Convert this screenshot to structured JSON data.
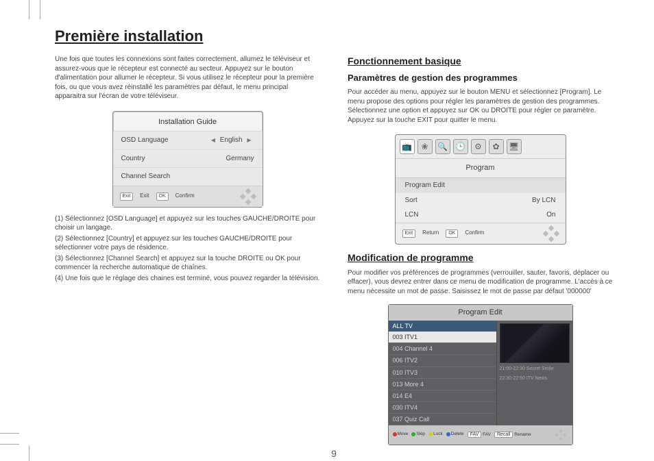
{
  "title": "Première installation",
  "page_number": "9",
  "left": {
    "intro": "Une fois que toutes les connexions sont faites correctement, allumez le téléviseur et assurez-vous que le récepteur est connecté au secteur. Appuyez sur le bouton d'alimentation pour allumer le récepteur. Si vous utilisez le récepteur pour la première fois, ou que vous avez réinstallé les paramètres par défaut, le menu principal apparaitra sur l'écran de votre téléviseur.",
    "osd": {
      "title": "Installation Guide",
      "osd_language_label": "OSD Language",
      "osd_language_value": "English",
      "country_label": "Country",
      "country_value": "Germany",
      "channel_search_label": "Channel Search",
      "exit_key": "Exit",
      "exit_label": "Exit",
      "ok_key": "OK",
      "ok_label": "Confirm"
    },
    "steps": {
      "s1": "(1) Sélectionnez [OSD Language] et appuyez sur les touches GAUCHE/DROITE pour choisir un langage.",
      "s2": "(2) Sélectionnez [Country] et appuyez sur les touches GAUCHE/DROITE pour sélectionner votre pays de résidence.",
      "s3": "(3) Sélectionnez [Channel Search] et appuyez sur la touche DROITE ou OK pour commencer la recherche automatique de chaînes.",
      "s4": "(4) Une fois que le réglage des chaines est terminé, vous pouvez regarder la télévision."
    }
  },
  "right": {
    "sec1_title": "Fonctionnement basique",
    "sec1_sub": "Paramètres de gestion des programmes",
    "sec1_body": "Pour accéder au menu, appuyez sur le bouton MENU et sélectionnez [Program]. Le menu propose des options pour régler les paramètres de gestion des programmes. Sélectionnez une option et appuyez sur OK ou DROITE pour régler ce paramètre. Appuyez sur la touche EXIT pour quitter le menu.",
    "osd2": {
      "title": "Program",
      "program_edit": "Program Edit",
      "sort_label": "Sort",
      "sort_value": "By LCN",
      "lcn_label": "LCN",
      "lcn_value": "On",
      "exit_key": "Exit",
      "exit_label": "Return",
      "ok_key": "OK",
      "ok_label": "Confirm"
    },
    "sec2_title": "Modification de programme",
    "sec2_body": "Pour modifier vos préférences de programmes (verrouiller, sauter, favoris, déplacer ou effacer), vous devrez entrer dans  ce menu de modification de programme. L'accès à ce menu nécessite un mot de passe. Saisissez le mot de passe par défaut '000000'",
    "osd3": {
      "title": "Program Edit",
      "header": "ALL TV",
      "channels": [
        "003 ITV1",
        "004 Channel 4",
        "006 ITV2",
        "010 ITV3",
        "013 More 4",
        "014 E4",
        "030 ITV4",
        "037 Quiz Call"
      ],
      "info1": "21:00-22:30  Secret Smile",
      "info2": "22:30-22:50  ITV News",
      "tools": {
        "move": "Move",
        "skip": "Skip",
        "lock": "Lock",
        "delete": "Delete",
        "fav_key": "FAV",
        "fav": "FAV",
        "recall_key": "Recall",
        "rename": "Rename"
      }
    }
  }
}
